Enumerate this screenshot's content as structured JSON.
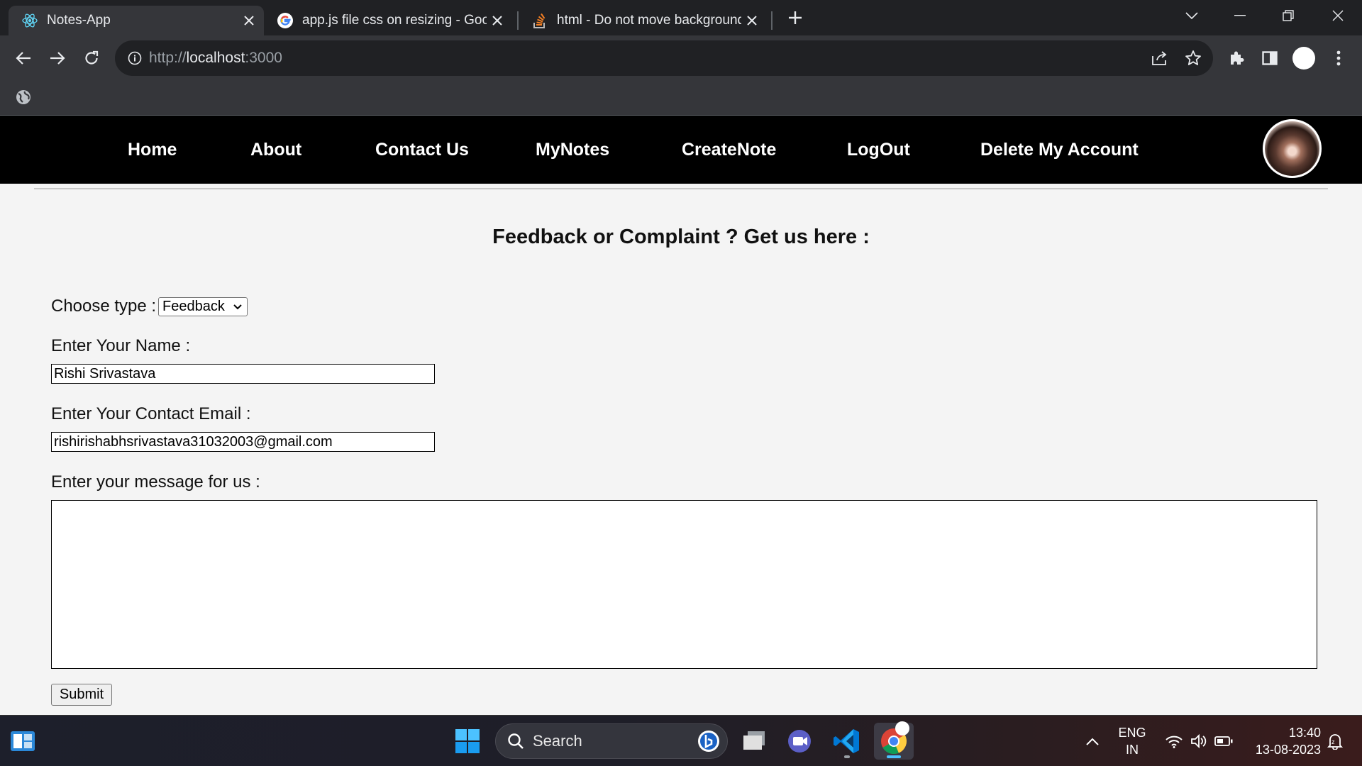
{
  "browser": {
    "tabs": [
      {
        "title": "Notes-App",
        "icon": "react-icon",
        "active": true
      },
      {
        "title": "app.js file css on resizing - Googl",
        "icon": "google-icon",
        "active": false
      },
      {
        "title": "html - Do not move background",
        "icon": "stackoverflow-icon",
        "active": false
      }
    ],
    "url": {
      "scheme": "http://",
      "host": "localhost",
      "port": ":3000"
    }
  },
  "nav": {
    "links": [
      "Home",
      "About",
      "Contact Us",
      "MyNotes",
      "CreateNote",
      "LogOut",
      "Delete My Account"
    ]
  },
  "form": {
    "heading": "Feedback or Complaint ? Get us here :",
    "type_label": "Choose type :",
    "type_value": "Feedback",
    "name_label": "Enter Your Name :",
    "name_value": "Rishi Srivastava",
    "email_label": "Enter Your Contact Email :",
    "email_value": "rishirishabhsrivastava31032003@gmail.com",
    "message_label": "Enter your message for us :",
    "message_value": "",
    "submit_label": "Submit"
  },
  "taskbar": {
    "search_placeholder": "Search",
    "lang_line1": "ENG",
    "lang_line2": "IN",
    "time": "13:40",
    "date": "13-08-2023"
  },
  "colors": {
    "navbar_bg": "#000000",
    "page_bg": "#f4f4f4",
    "browser_dark": "#202124",
    "browser_toolbar": "#35363a"
  }
}
